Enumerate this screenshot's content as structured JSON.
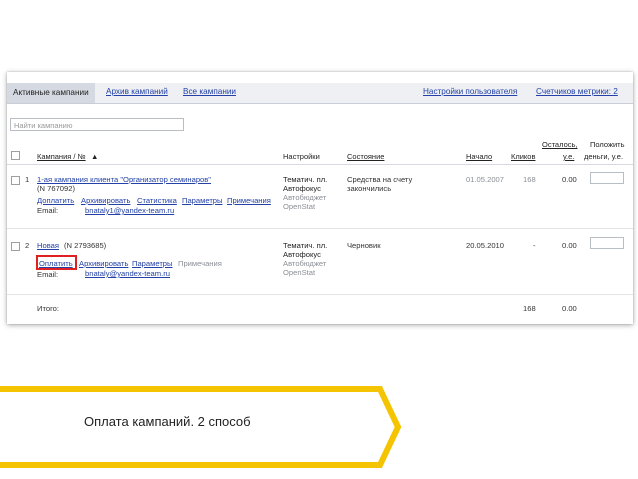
{
  "tabs": {
    "active": "Активные кампании",
    "archive": "Архив кампаний",
    "all": "Все кампании",
    "user_settings": "Настройки пользователя",
    "metrika_counters": "Счетчиков метрики: 2"
  },
  "search": {
    "placeholder": "Найти кампанию"
  },
  "columns": {
    "campaign": "Кампания / №",
    "sort_arrow": "▲",
    "settings": "Настройки",
    "state": "Состояние",
    "start": "Начало",
    "clicks": "Кликов",
    "remaining_l1": "Осталось,",
    "remaining_l2": "у.е.",
    "deposit_l1": "Положить",
    "deposit_l2": "деньги, у.е."
  },
  "rows": [
    {
      "num": "1",
      "name": "1-ая кампания клиента \"Организатор семинаров\"",
      "id": "(N 767092)",
      "actions": [
        "Доплатить",
        "Архивировать",
        "Статистика",
        "Параметры",
        "Примечания"
      ],
      "email_label": "Email:",
      "email": "bnataly1@yandex-team.ru",
      "settings": [
        "Тематич. пл.",
        "Автофокус",
        "Автобюджет",
        "OpenStat"
      ],
      "state": [
        "Средства на счету",
        "закончились"
      ],
      "start": "01.05.2007",
      "clicks": "168",
      "remaining": "0.00"
    },
    {
      "num": "2",
      "name": "Новая",
      "id": "(N 2793685)",
      "actions": [
        "Оплатить",
        "Архивировать",
        "Параметры",
        "Примечания"
      ],
      "email_label": "Email:",
      "email": "bnataly@yandex-team.ru",
      "settings": [
        "Тематич. пл.",
        "Автофокус",
        "Автобюджет",
        "OpenStat"
      ],
      "state": [
        "Черновик"
      ],
      "start": "20.05.2010",
      "clicks": "-",
      "remaining": "0.00"
    }
  ],
  "total": {
    "label": "Итого:",
    "clicks": "168",
    "remaining": "0.00"
  },
  "caption": "Оплата кампаний. 2 способ",
  "colors": {
    "accent_yellow": "#f5c400",
    "link": "#2341a6",
    "highlight_red": "#e02020"
  }
}
